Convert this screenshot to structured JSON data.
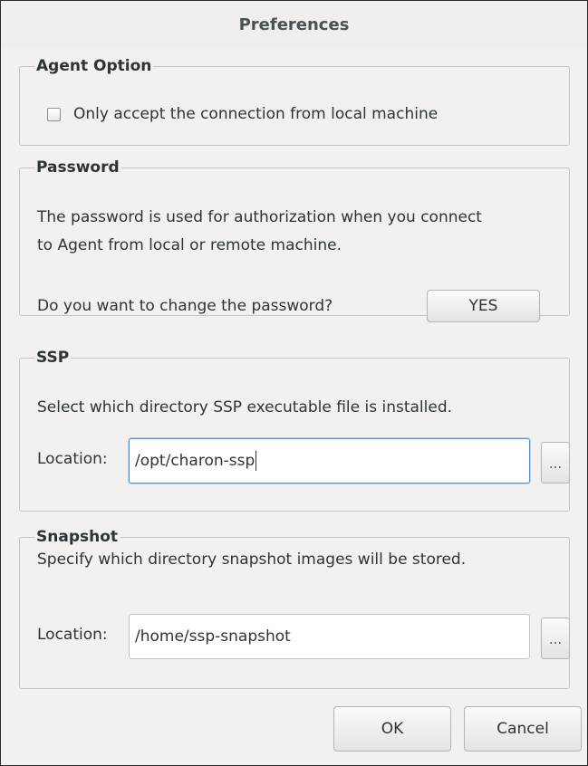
{
  "window": {
    "title": "Preferences"
  },
  "agent_option": {
    "legend": "Agent Option",
    "checkbox_label": "Only accept the connection from local machine",
    "checked": false
  },
  "password": {
    "legend": "Password",
    "description_line1": "The password is used for authorization when you connect",
    "description_line2": "to Agent from local or remote machine.",
    "question": "Do you want to change the password?",
    "yes_label": "YES"
  },
  "ssp": {
    "legend": "SSP",
    "description": "Select which directory SSP executable file is installed.",
    "location_label": "Location:",
    "location_value": "/opt/charon-ssp",
    "browse_label": "..."
  },
  "snapshot": {
    "legend": "Snapshot",
    "description": "Specify which directory snapshot images will be stored.",
    "location_label": "Location:",
    "location_value": "/home/ssp-snapshot",
    "browse_label": "..."
  },
  "buttons": {
    "ok": "OK",
    "cancel": "Cancel"
  },
  "colors": {
    "focus": "#4a90d9",
    "window_bg": "#f2f1f0"
  }
}
